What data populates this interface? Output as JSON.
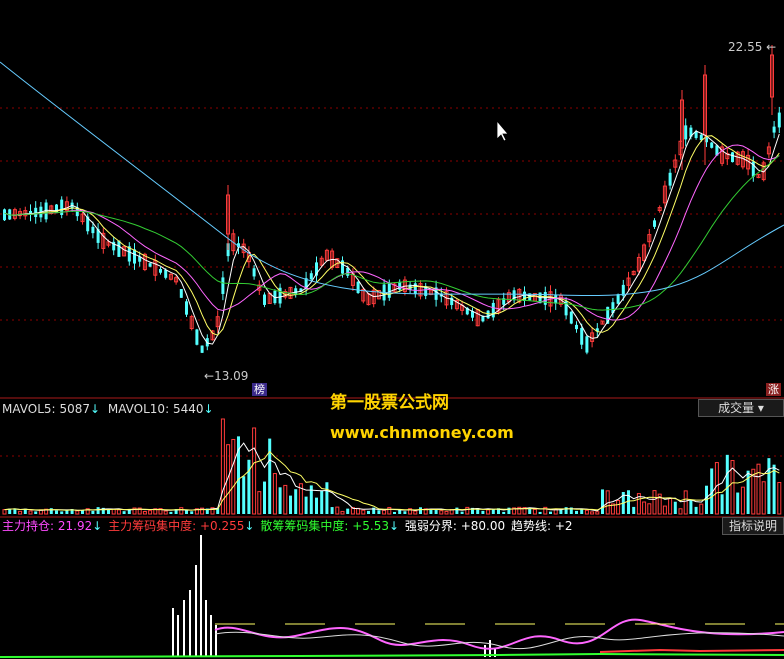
{
  "price_panel": {
    "high_label": "22.55",
    "low_label": "13.09",
    "markers": {
      "bang": "榜",
      "zhang": "涨"
    }
  },
  "volume_panel": {
    "mavol5_label": "MAVOL5:",
    "mavol5_value": "5087",
    "mavol10_label": "MAVOL10:",
    "mavol10_value": "5440",
    "arrow": "↓",
    "selector_label": "成交量"
  },
  "indicator_panel": {
    "items": [
      {
        "label": "主力持仓:",
        "value": "21.92",
        "arrow": "↓",
        "color": "#ff4bff"
      },
      {
        "label": "主力筹码集中度:",
        "value": "+0.255",
        "arrow": "↓",
        "color": "#ff3b3b"
      },
      {
        "label": "散筹筹码集中度:",
        "value": "+5.53",
        "arrow": "↓",
        "color": "#30ff30"
      },
      {
        "label": "强弱分界:",
        "value": "+80.00",
        "arrow": "",
        "color": "#ffffff"
      },
      {
        "label": "趋势线:",
        "value": "+2",
        "arrow": "",
        "color": "#ffffff"
      }
    ],
    "help_button": "指标说明"
  },
  "watermark": {
    "title": "第一股票公式网",
    "url": "www.chnmoney.com"
  },
  "colors": {
    "up": "#ff3b3b",
    "down": "#54ffff",
    "ma_white": "#ffffff",
    "ma_yellow": "#ffff66",
    "ma_magenta": "#ff66ff",
    "ma_green": "#33cc33",
    "ma_blue": "#66ccff",
    "grid": "#8b0000",
    "label_cyan": "#54ffff"
  }
}
